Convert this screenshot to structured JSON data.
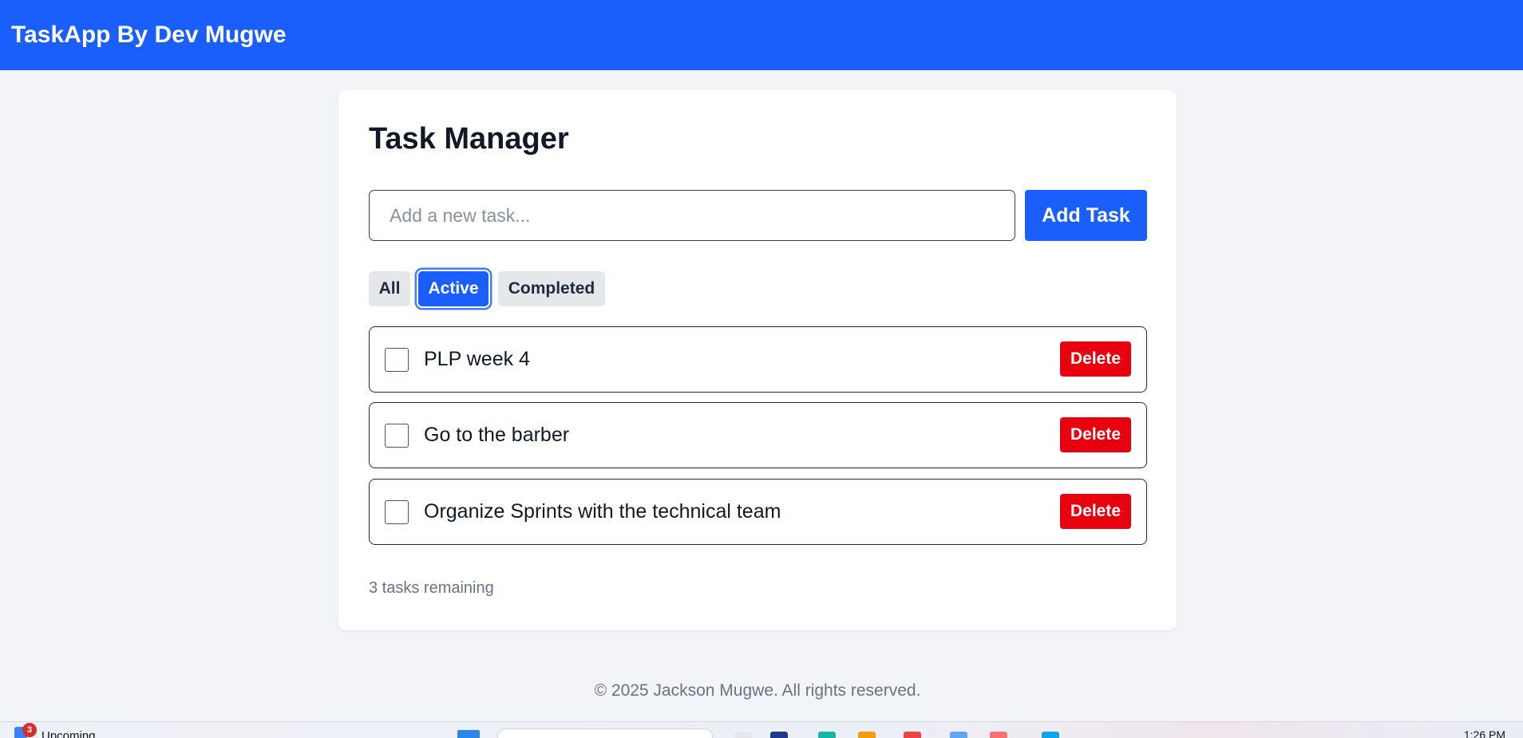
{
  "app": {
    "brand": "TaskApp By Dev Mugwe"
  },
  "main": {
    "title": "Task Manager",
    "input_placeholder": "Add a new task...",
    "input_value": "",
    "add_button_label": "Add Task",
    "filters": [
      {
        "label": "All",
        "selected": false
      },
      {
        "label": "Active",
        "selected": true
      },
      {
        "label": "Completed",
        "selected": false
      }
    ],
    "tasks": [
      {
        "text": "PLP week 4",
        "completed": false,
        "delete_label": "Delete"
      },
      {
        "text": "Go to the barber",
        "completed": false,
        "delete_label": "Delete"
      },
      {
        "text": "Organize Sprints with the technical team",
        "completed": false,
        "delete_label": "Delete"
      }
    ],
    "remaining_text": "3 tasks remaining"
  },
  "footer": {
    "text": "© 2025 Jackson Mugwe. All rights reserved."
  },
  "taskbar": {
    "widget_badge": "3",
    "widget_label": "Upcoming",
    "clock": "1:26 PM"
  },
  "colors": {
    "primary": "#1a5ffc",
    "danger": "#e8000f",
    "page_bg": "#f2f4f7",
    "muted_text": "#6b7280"
  }
}
